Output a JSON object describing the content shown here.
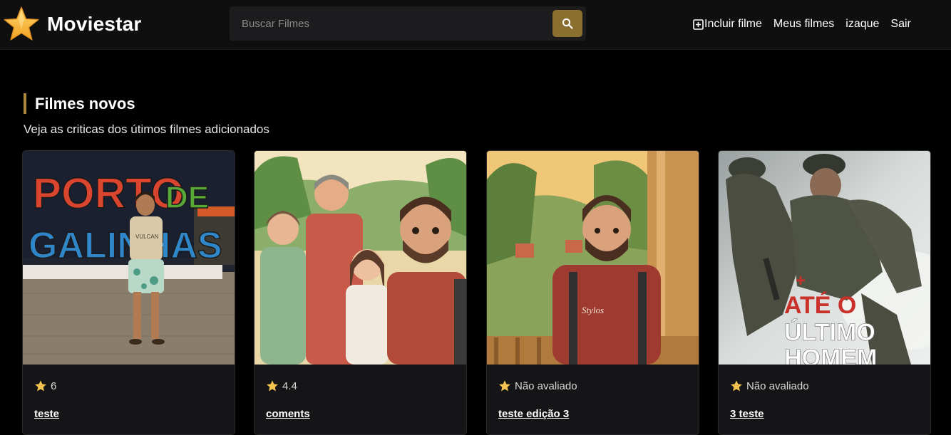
{
  "header": {
    "brand": "Moviestar",
    "logo_icon": "star-icon",
    "search": {
      "placeholder": "Buscar Filmes",
      "value": "",
      "button_icon": "search-icon"
    },
    "nav": [
      {
        "label": "Incluir filme",
        "icon": "plus-square-icon"
      },
      {
        "label": "Meus filmes"
      },
      {
        "label": "izaque"
      },
      {
        "label": "Sair"
      }
    ]
  },
  "section": {
    "title": "Filmes novos",
    "subtitle": "Veja as criticas dos útimos filmes adicionados"
  },
  "movies": [
    {
      "rating": "6",
      "title": "teste"
    },
    {
      "rating": "4.4",
      "title": "coments"
    },
    {
      "rating": "Não avaliado",
      "title": "teste edição 3"
    },
    {
      "rating": "Não avaliado",
      "title": "3 teste"
    }
  ],
  "posters": [
    {
      "text_lines": [
        "PORTO",
        "DE",
        "GALINHAS",
        "VULCAN"
      ]
    },
    {
      "text_lines": []
    },
    {
      "text_lines": [
        "Stylos"
      ]
    },
    {
      "text_lines": [
        "+",
        "ATÉ O",
        "ÚLTIMO",
        "HOMEM"
      ]
    }
  ],
  "colors": {
    "background": "#000000",
    "header": "#0f0f10",
    "accent": "#8b6f2f",
    "section_bar": "#a8893b",
    "star": "#f5c451",
    "card": "#151517"
  }
}
